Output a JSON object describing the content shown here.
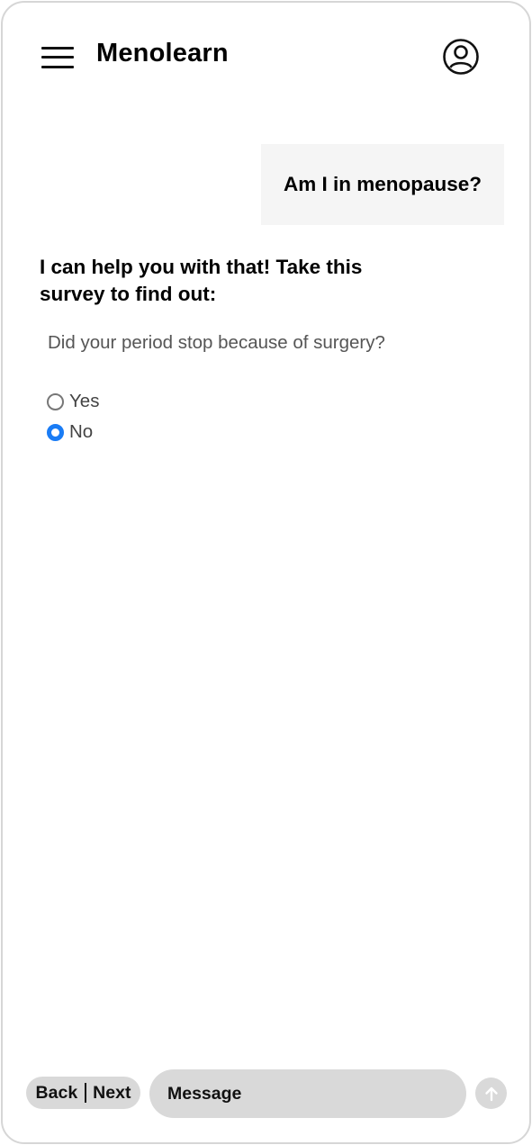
{
  "header": {
    "title": "Menolearn",
    "menu_icon": "hamburger-menu-icon",
    "profile_icon": "user-circle-icon"
  },
  "chat": {
    "user_message": "Am I in menopause?",
    "bot_reply": "I can help you with that! Take this survey to find out:"
  },
  "survey": {
    "question": "Did your period stop because of surgery?",
    "options": [
      {
        "label": "Yes",
        "selected": false
      },
      {
        "label": "No",
        "selected": true
      }
    ]
  },
  "footer": {
    "back_label": "Back",
    "next_label": "Next",
    "message_placeholder": "Message",
    "send_icon": "arrow-up-icon"
  },
  "colors": {
    "accent": "#1a7cf5",
    "bubble_bg": "#f5f5f5",
    "control_bg": "#d9d9d9"
  }
}
